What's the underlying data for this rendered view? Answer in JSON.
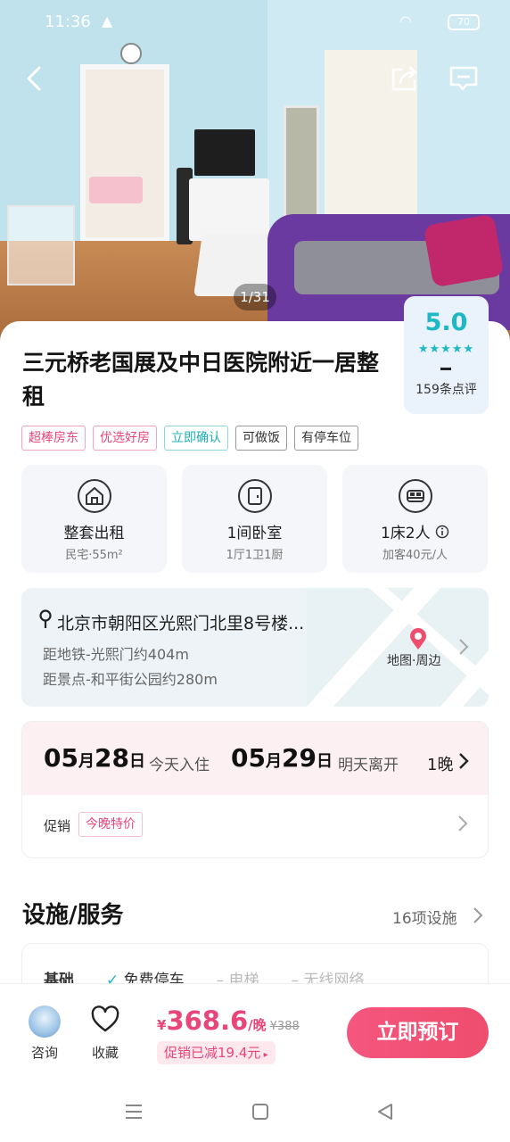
{
  "status_bar": {
    "time": "11:36",
    "battery": "70"
  },
  "hero": {
    "photo_counter": "1/31"
  },
  "listing": {
    "title": "三元桥老国展及中日医院附近一居整租",
    "rating": {
      "score": "5.0",
      "stars": "★★★★★",
      "review_count": "159条点评"
    },
    "tags": [
      {
        "label": "超棒房东",
        "style": "pink"
      },
      {
        "label": "优选好房",
        "style": "pink"
      },
      {
        "label": "立即确认",
        "style": "teal"
      },
      {
        "label": "可做饭",
        "style": "gray"
      },
      {
        "label": "有停车位",
        "style": "gray"
      }
    ],
    "features": [
      {
        "icon": "house-icon",
        "main": "整套出租",
        "sub": "民宅·55m²"
      },
      {
        "icon": "door-icon",
        "main": "1间卧室",
        "sub": "1厅1卫1厨"
      },
      {
        "icon": "bed-icon",
        "main": "1床2人",
        "sub": "加客40元/人"
      }
    ]
  },
  "location": {
    "address": "北京市朝阳区光熙门北里8号楼...",
    "metro": "距地铁-光熙门约404m",
    "scenic": "距景点-和平街公园约280m",
    "map_label": "地图·周边"
  },
  "dates": {
    "checkin_month": "05",
    "checkin_day": "28",
    "checkin_note": "今天入住",
    "checkout_month": "05",
    "checkout_day": "29",
    "checkout_note": "明天离开",
    "month_unit": "月",
    "day_unit": "日",
    "nights": "1晚",
    "promo_label": "促销",
    "promo_tag": "今晚特价"
  },
  "facilities": {
    "title": "设施/服务",
    "count": "16项设施",
    "row_label": "基础",
    "items": [
      "免费停车",
      "电梯",
      "无线网络"
    ]
  },
  "bottom_bar": {
    "consult_label": "咨询",
    "favorite_label": "收藏",
    "currency": "¥",
    "price": "368.6",
    "price_unit": "/晚",
    "original_price": "¥388",
    "promo_text": "促销已减19.4元",
    "book_label": "立即预订"
  },
  "colors": {
    "accent": "#ef4d6e",
    "teal": "#1db8c3"
  }
}
